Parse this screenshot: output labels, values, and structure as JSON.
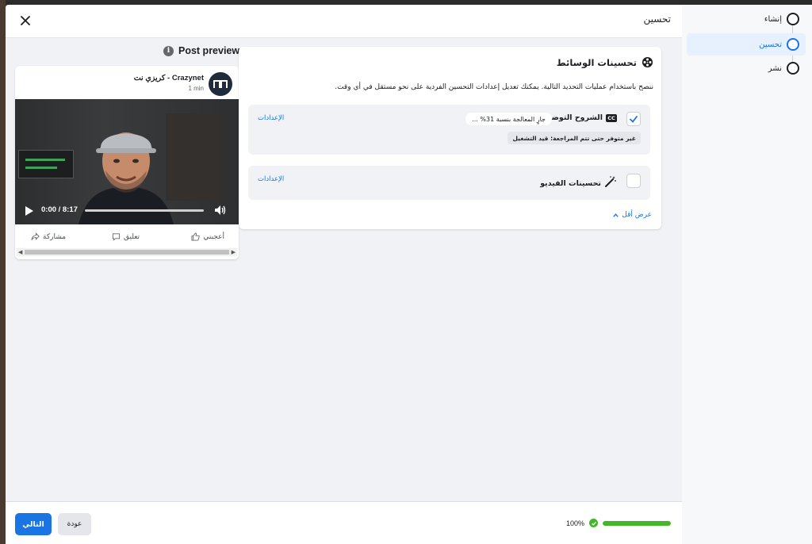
{
  "header": {
    "title": "تحسين"
  },
  "preview": {
    "label": "Post preview",
    "page_name": "كريزي نت - Crazynet",
    "time": "1 min",
    "video_time": "0:00 / 8:17",
    "actions": {
      "like": "أعجبني",
      "comment": "تعليق",
      "share": "مشاركة"
    }
  },
  "enhancements": {
    "title": "تحسينات الوسائط",
    "description": "ننصح باستخدام عمليات التحديد التالية. يمكنك تعديل إعدادات التحسين الفردية على نحو مستقل في أي وقت.",
    "options": [
      {
        "label": "الشروح التوضيحية",
        "icon": "cc-icon",
        "checked": true,
        "status": "جارٍ المعالجة بنسبة 31% ...",
        "note": "غير متوفر حتى تتم المراجعة: قيد التشغيل",
        "settings": "الإعدادات"
      },
      {
        "label": "تحسينات الفيديو",
        "icon": "magic-wand-icon",
        "checked": false,
        "settings": "الإعدادات"
      }
    ],
    "show_less": "عرض أقل"
  },
  "footer": {
    "next": "التالي",
    "back": "عودة",
    "progress_text": "100%",
    "progress_value": 100
  },
  "steps": [
    {
      "label": "إنشاء",
      "active": false
    },
    {
      "label": "تحسين",
      "active": true
    },
    {
      "label": "نشر",
      "active": false
    }
  ],
  "colors": {
    "accent": "#1b74e4",
    "success": "#42b72a",
    "background": "#f0f2f5"
  }
}
